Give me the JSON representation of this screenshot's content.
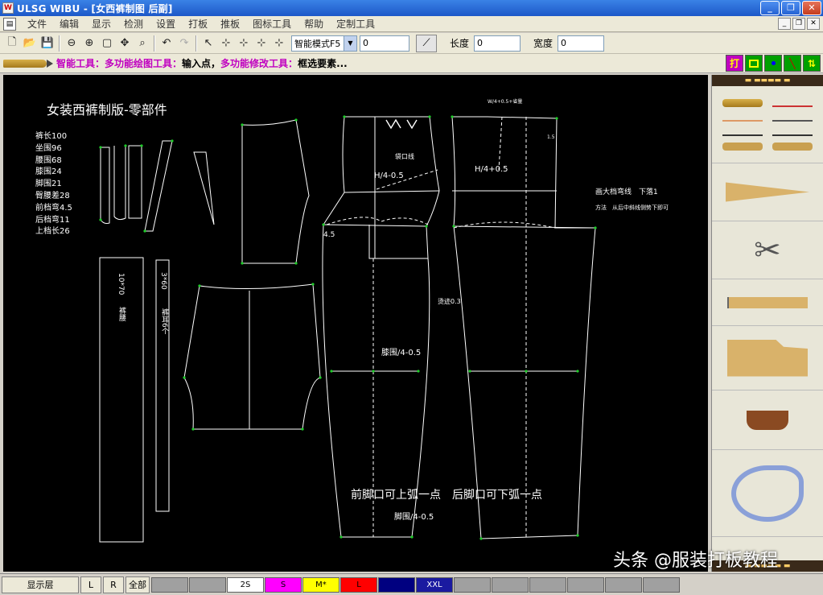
{
  "window": {
    "app_icon": "app-logo-icon",
    "title": "ULSG WIBU - [女西裤制图 后副]",
    "controls": [
      "minimize-icon",
      "maximize-icon",
      "close-icon"
    ]
  },
  "menu": {
    "items": [
      "文件",
      "编辑",
      "显示",
      "检测",
      "设置",
      "打板",
      "推板",
      "图标工具",
      "帮助",
      "定制工具"
    ]
  },
  "toolbar": {
    "mode_select": "智能模式F5",
    "value_field": "0",
    "length_label": "长度",
    "length_value": "0",
    "width_label": "宽度",
    "width_value": "0"
  },
  "hint": {
    "smart_tool": "智能工具：",
    "draw_tool": "多功能绘图工具：",
    "draw_value": "输入点，",
    "modify_tool": "多功能修改工具：",
    "modify_value": "框选要素..."
  },
  "mode_buttons": [
    "打",
    "",
    "",
    "",
    ""
  ],
  "canvas": {
    "title": "女装西裤制版-零部件",
    "measurements": [
      "裤长100",
      "坐围96",
      "腰围68",
      "膝围24",
      "脚围21",
      "臀腰差28",
      "前档弯4.5",
      "后档弯11",
      "上档长26"
    ],
    "labels": {
      "waistband_size": "10*70",
      "waistband_name": "裤腰",
      "beltloop_size": "3*60",
      "beltloop_name": "裤耳6个",
      "front_hip": "H/4-0.5",
      "pocket": "袋口线",
      "front_crotch": "4.5",
      "back_hip": "H/4+0.5",
      "back_top": "W/4+0.5+省量",
      "back_side": "1.5",
      "crotch_note_1": "画大档弯线　下落1",
      "crotch_note_2": "方法　从后中斜线侧势下即可",
      "front_center": "烫迹0.3",
      "knee": "膝围/4-0.5",
      "hem_note": "前脚口可上弧一点　后脚口可下弧一点",
      "hem": "脚围/4-0.5"
    }
  },
  "status": {
    "layer_button": "显示层",
    "left_button": "L",
    "right_button": "R",
    "all_button": "全部",
    "sizes": [
      {
        "label": "",
        "color": "#a0a0a0"
      },
      {
        "label": "",
        "color": "#a0a0a0"
      },
      {
        "label": "2S",
        "color": "#ffffff"
      },
      {
        "label": "S",
        "color": "#ff00ff"
      },
      {
        "label": "M*",
        "color": "#ffff00"
      },
      {
        "label": "L",
        "color": "#ff0000"
      },
      {
        "label": "",
        "color": "#000080"
      },
      {
        "label": "XXL",
        "color": "#1a1aa0"
      },
      {
        "label": "",
        "color": "#a0a0a0"
      },
      {
        "label": "",
        "color": "#a0a0a0"
      },
      {
        "label": "",
        "color": "#a0a0a0"
      },
      {
        "label": "",
        "color": "#a0a0a0"
      },
      {
        "label": "",
        "color": "#a0a0a0"
      },
      {
        "label": "",
        "color": "#a0a0a0"
      }
    ]
  },
  "watermark": "头条 @服装打板教程"
}
